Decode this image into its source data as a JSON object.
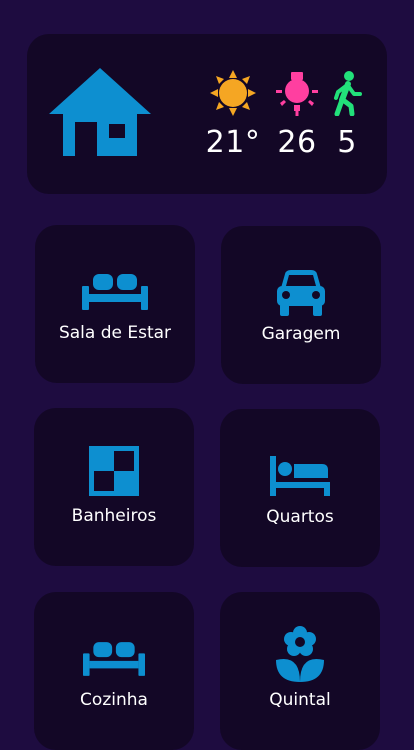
{
  "colors": {
    "background": "#1e0c40",
    "card": "#130726",
    "accent_blue": "#0d8fd0",
    "sun_orange": "#f5a623",
    "bulb_pink": "#ff3fa0",
    "motion_green": "#22e07a"
  },
  "header": {
    "icon": "house-icon",
    "sensors": {
      "temperature": {
        "icon": "sun-moon-icon",
        "value": "21°"
      },
      "light": {
        "icon": "lightbulb-icon",
        "value": "26"
      },
      "motion": {
        "icon": "walking-person-icon",
        "value": "5"
      }
    }
  },
  "rooms": [
    {
      "label": "Sala de Estar",
      "icon": "sofa-icon"
    },
    {
      "label": "Garagem",
      "icon": "car-icon"
    },
    {
      "label": "Banheiros",
      "icon": "checker-tile-icon"
    },
    {
      "label": "Quartos",
      "icon": "bed-icon"
    },
    {
      "label": "Cozinha",
      "icon": "sofa-icon"
    },
    {
      "label": "Quintal",
      "icon": "flower-icon"
    }
  ]
}
